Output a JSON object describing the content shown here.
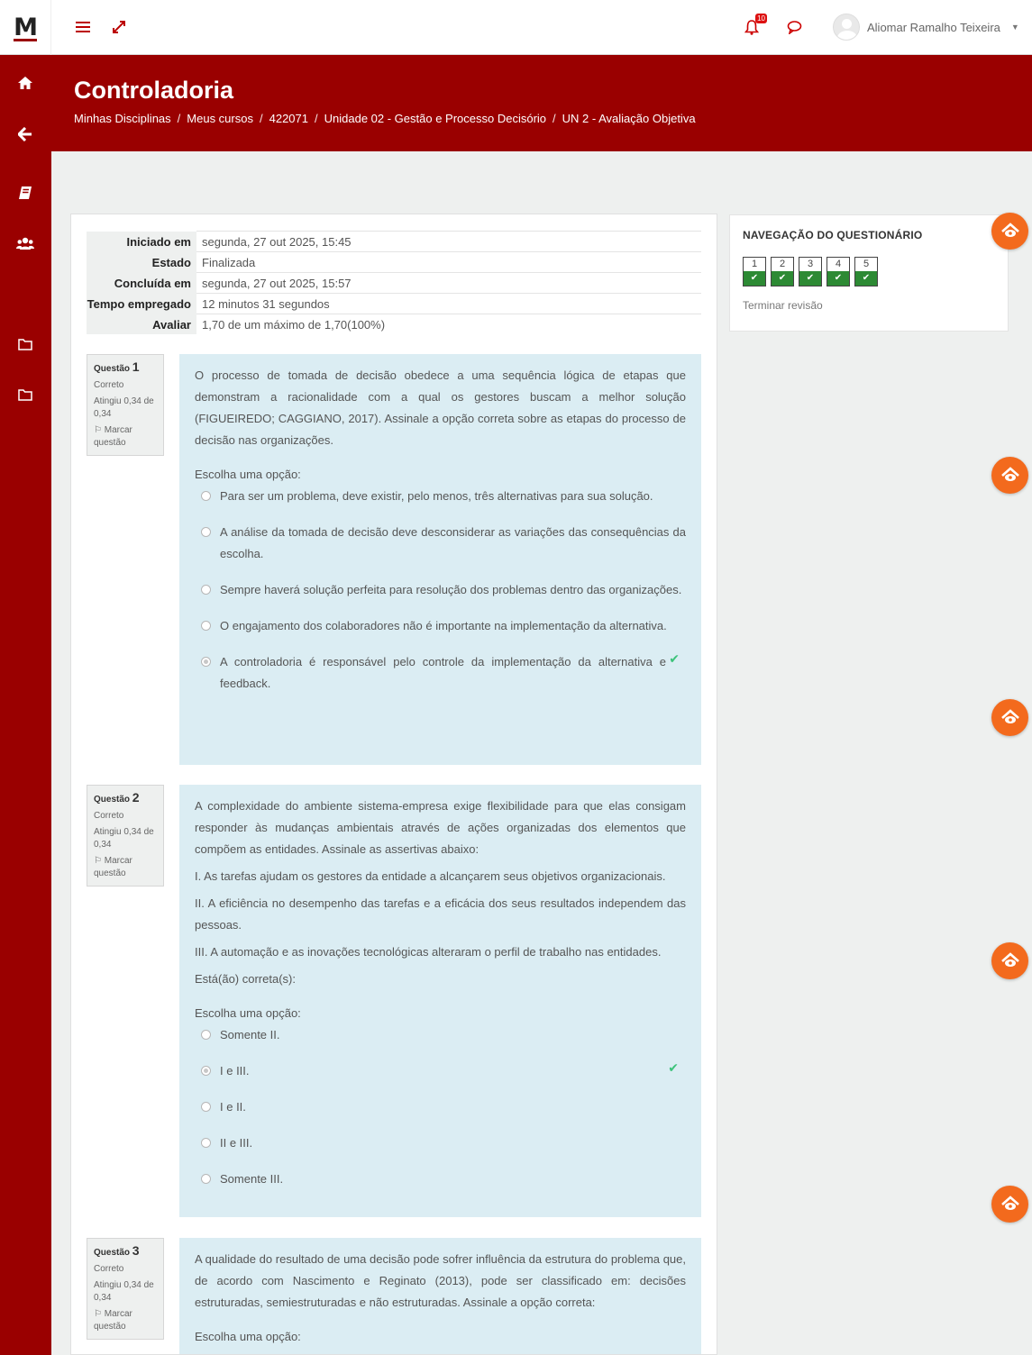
{
  "brand": {
    "logo_text": "M"
  },
  "topbar": {
    "notification_count": "10",
    "user_name": "Aliomar Ramalho Teixeira"
  },
  "header": {
    "title": "Controladoria",
    "breadcrumb": [
      "Minhas Disciplinas",
      "Meus cursos",
      "422071",
      "Unidade 02 - Gestão e Processo Decisório",
      "UN 2 - Avaliação Objetiva"
    ]
  },
  "summary": [
    {
      "label": "Iniciado em",
      "value": "segunda, 27 out 2025, 15:45"
    },
    {
      "label": "Estado",
      "value": "Finalizada"
    },
    {
      "label": "Concluída em",
      "value": "segunda, 27 out 2025, 15:57"
    },
    {
      "label": "Tempo empregado",
      "value": "12 minutos 31 segundos"
    },
    {
      "label": "Avaliar",
      "value": "1,70 de um máximo de 1,70(100%)"
    }
  ],
  "questions": [
    {
      "label": "Questão",
      "number": "1",
      "status": "Correto",
      "score": "Atingiu 0,34 de 0,34",
      "flag": "Marcar questão",
      "text": "O processo de tomada de decisão obedece a uma sequência lógica de etapas que demonstram a racionalidade com a qual os gestores buscam a melhor solução (FIGUEIREDO; CAGGIANO, 2017). Assinale a opção correta sobre as etapas do processo de decisão nas organizações.",
      "prompt": "Escolha uma opção:",
      "options": [
        "Para ser um problema, deve existir, pelo menos, três alternativas para sua solução.",
        "A análise da tomada de decisão deve desconsiderar as variações das consequências da escolha.",
        "Sempre haverá solução perfeita para resolução dos problemas dentro das organizações.",
        "O engajamento dos colaboradores não é importante na implementação da alternativa.",
        "A controladoria é responsável pelo controle da implementação da alternativa e feedback."
      ]
    },
    {
      "label": "Questão",
      "number": "2",
      "status": "Correto",
      "score": "Atingiu 0,34 de 0,34",
      "flag": "Marcar questão",
      "text": "A complexidade do ambiente sistema-empresa exige flexibilidade para que elas consigam responder às mudanças ambientais através de ações organizadas dos elementos que compõem as entidades. Assinale as assertivas abaixo:",
      "statements": [
        "I. As tarefas ajudam os gestores da entidade a alcançarem seus objetivos organizacionais.",
        "II. A eficiência no desempenho das tarefas e a eficácia dos seus resultados independem das pessoas.",
        "III. A automação e as inovações tecnológicas alteraram o perfil de trabalho nas entidades.",
        "Está(ão) correta(s):"
      ],
      "prompt": "Escolha uma opção:",
      "options": [
        "Somente II.",
        "I e III.",
        "I e II.",
        "II e III.",
        "Somente III."
      ]
    },
    {
      "label": "Questão",
      "number": "3",
      "status": "Correto",
      "score": "Atingiu 0,34 de 0,34",
      "flag": "Marcar questão",
      "text": "A qualidade do resultado de uma decisão pode sofrer influência da estrutura do problema que, de acordo com Nascimento e Reginato (2013), pode ser classificado em: decisões estruturadas, semiestruturadas e não estruturadas. Assinale a opção correta:",
      "prompt": "Escolha uma opção:"
    }
  ],
  "quiz_nav": {
    "title": "NAVEGAÇÃO DO QUESTIONÁRIO",
    "buttons": [
      "1",
      "2",
      "3",
      "4",
      "5"
    ],
    "finish_label": "Terminar revisão"
  },
  "colors": {
    "brand_red": "#9a0000",
    "answer_bg": "#dbedf3",
    "correct_green": "#2d8a34",
    "float_orange": "#f36a1d"
  },
  "icons": [
    "hamburger-icon",
    "expand-icon",
    "bell-icon",
    "chat-icon",
    "home-icon",
    "arrow-left-icon",
    "book-icon",
    "users-icon",
    "folder-icon",
    "flag-icon",
    "check-icon",
    "support-icon"
  ]
}
